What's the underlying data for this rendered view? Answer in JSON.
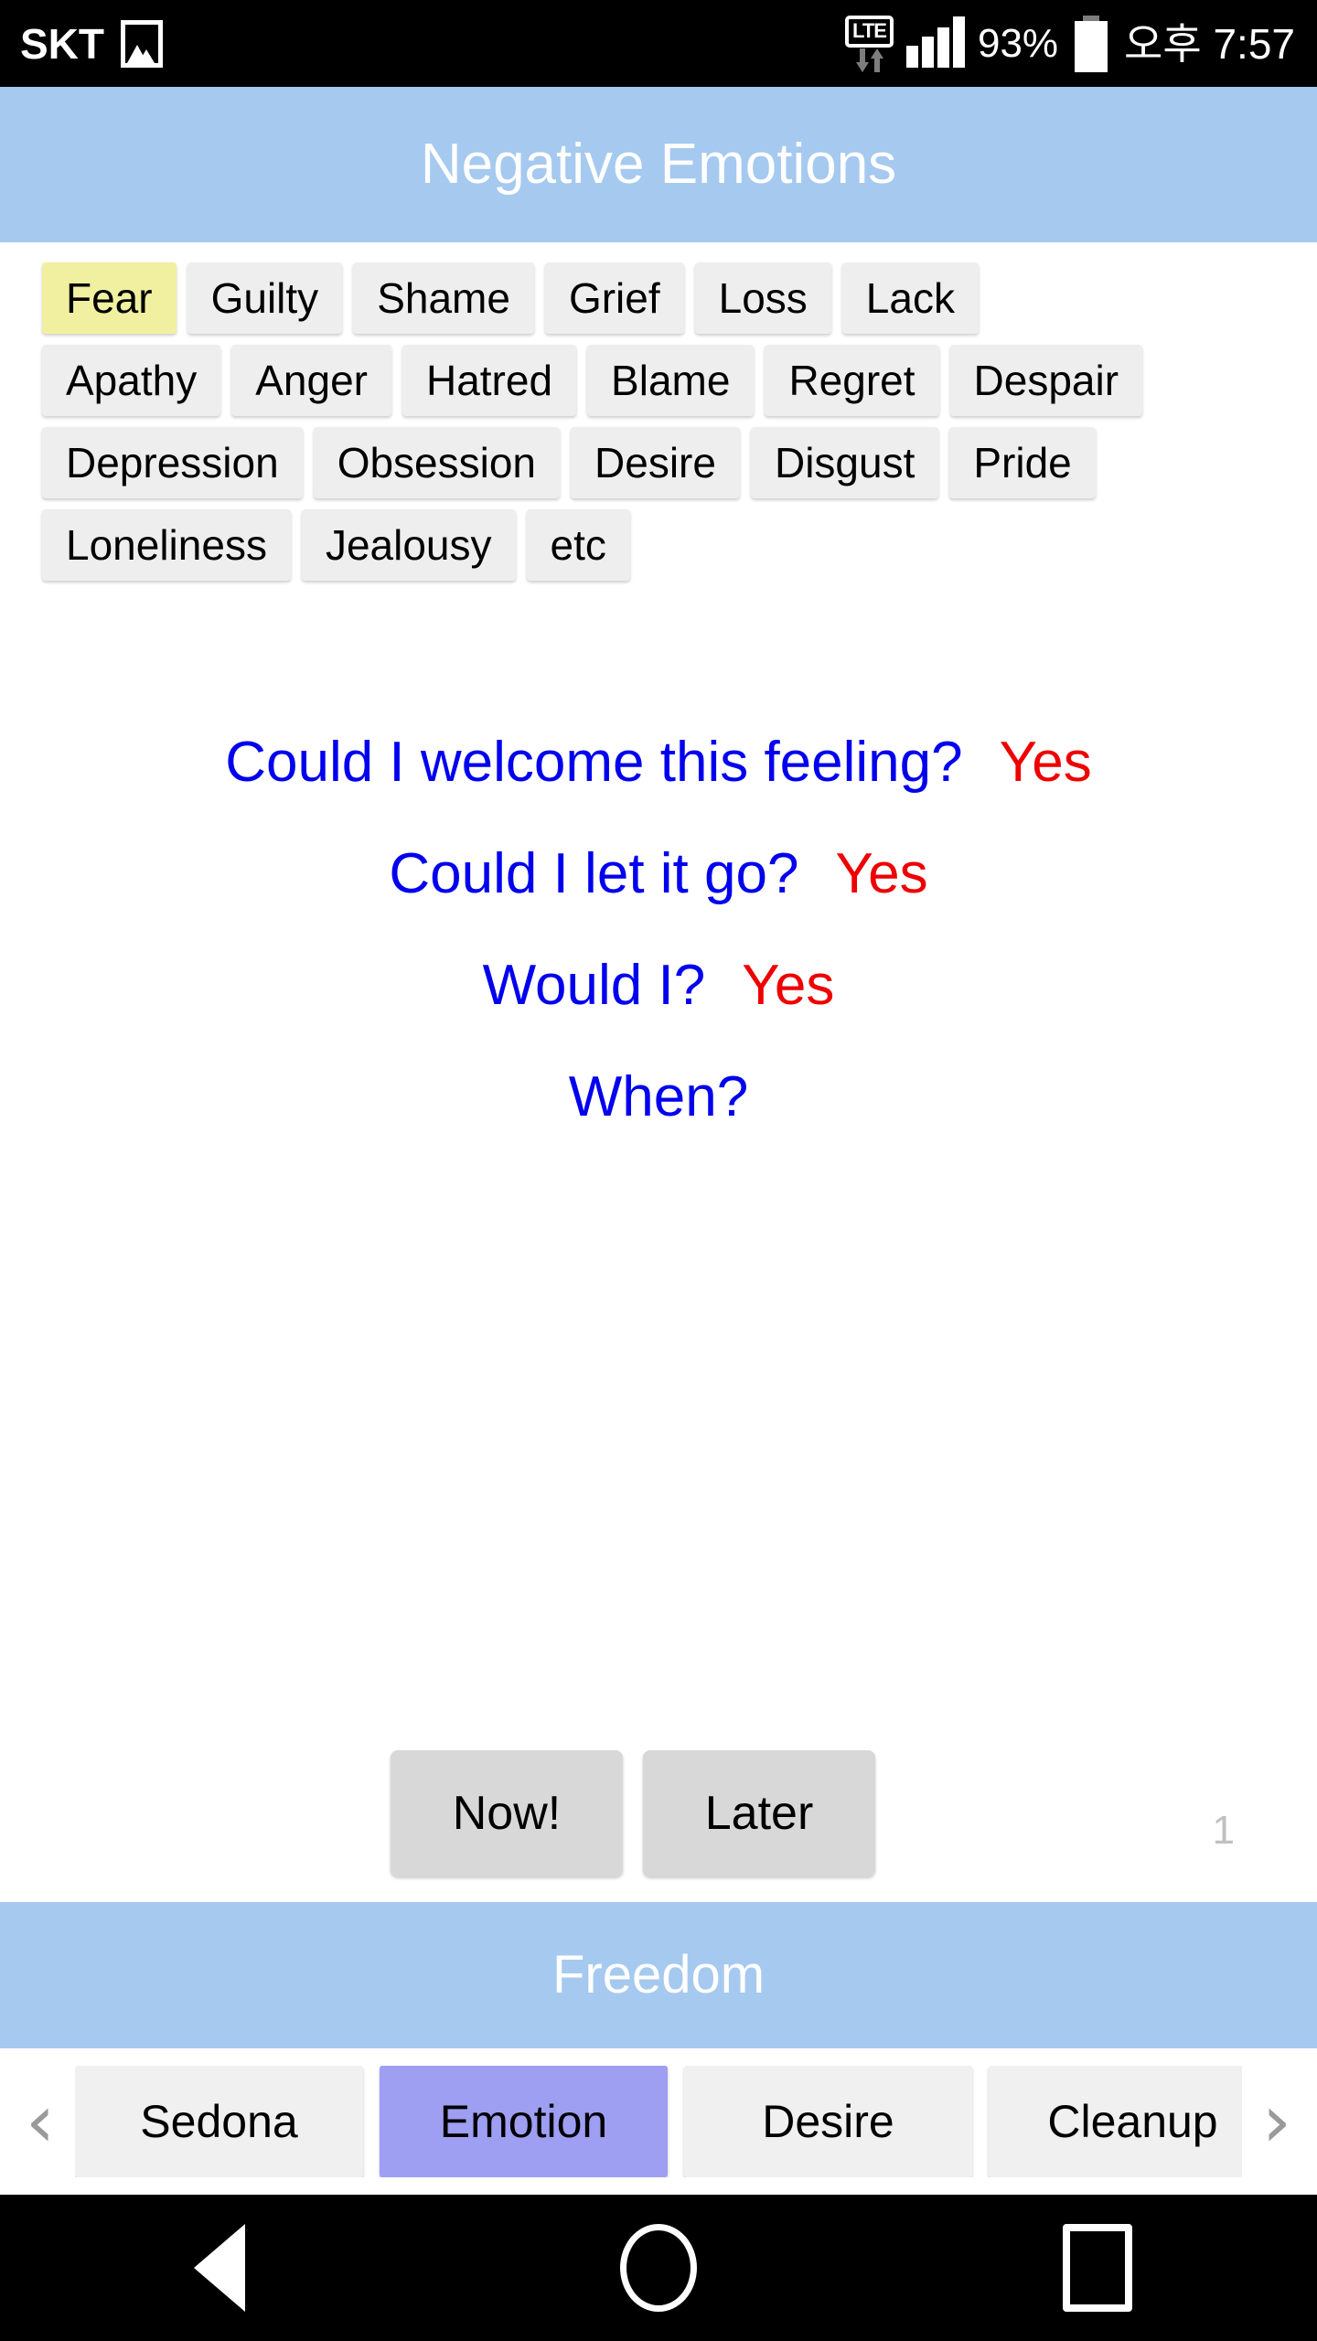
{
  "status_bar": {
    "carrier": "SKT",
    "gallery_icon": "image-icon",
    "network": "LTE",
    "battery_percent": "93%",
    "time": "오후 7:57"
  },
  "header": {
    "title": "Negative Emotions"
  },
  "emotions": {
    "selected": "Fear",
    "rows": [
      [
        "Fear",
        "Guilty",
        "Shame",
        "Grief",
        "Loss",
        "Lack"
      ],
      [
        "Apathy",
        "Anger",
        "Hatred",
        "Blame",
        "Regret",
        "Despair"
      ],
      [
        "Depression",
        "Obsession",
        "Desire",
        "Disgust",
        "Pride"
      ],
      [
        "Loneliness",
        "Jealousy",
        "etc"
      ]
    ]
  },
  "questions": [
    {
      "question": "Could I welcome this feeling?",
      "answer": "Yes"
    },
    {
      "question": "Could I let it go?",
      "answer": "Yes"
    },
    {
      "question": "Would I?",
      "answer": "Yes"
    },
    {
      "question": "When?",
      "answer": ""
    }
  ],
  "actions": {
    "now_label": "Now!",
    "later_label": "Later",
    "counter": "1"
  },
  "footer": {
    "title": "Freedom"
  },
  "tabbar": {
    "prev_icon": "‹",
    "next_icon": "›",
    "active": "Emotion",
    "tabs": [
      "Sedona",
      "Emotion",
      "Desire",
      "Cleanup"
    ]
  },
  "navbar": {
    "back": "back-icon",
    "home": "home-icon",
    "recents": "recents-icon"
  },
  "colors": {
    "header_blue": "#a6c9ef",
    "selected_chip": "#f0f0a0",
    "chip": "#eeeeee",
    "active_tab": "#9e9ef2",
    "question": "#0000ee",
    "answer": "#ee0000"
  }
}
